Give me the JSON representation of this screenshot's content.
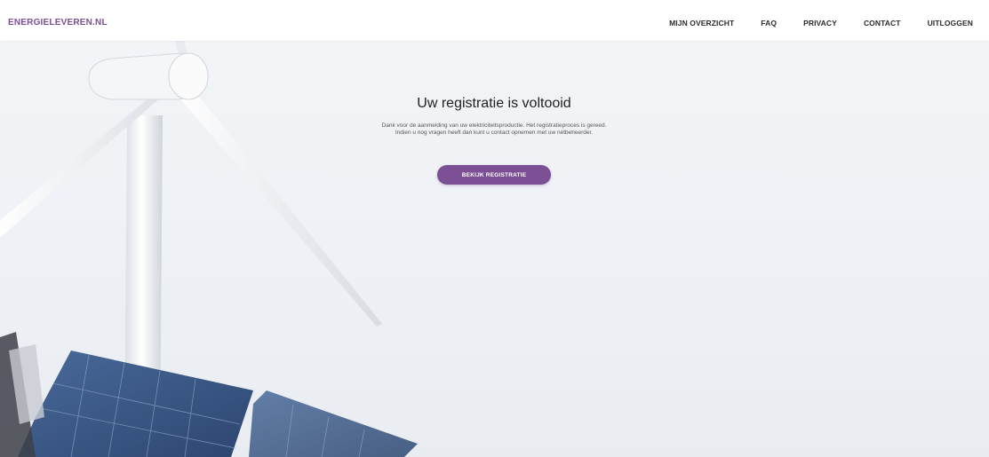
{
  "header": {
    "brand": "ENERGIELEVEREN.NL",
    "nav": [
      {
        "label": "MIJN OVERZICHT"
      },
      {
        "label": "FAQ"
      },
      {
        "label": "PRIVACY"
      },
      {
        "label": "CONTACT"
      },
      {
        "label": "UITLOGGEN"
      }
    ]
  },
  "main": {
    "title": "Uw registratie is voltooid",
    "message_line1": "Dank voor de aanmelding van uw elektriciteitsproductie. Het registratieproces is gereed.",
    "message_line2": "Indien u nog vragen heeft dan kunt u contact opnemen met uw netbeheerder.",
    "button_label": "BEKIJK REGISTRATIE"
  },
  "colors": {
    "accent": "#7a4f93",
    "background": "#f4f6f9",
    "nav_text": "#2b2b2b"
  }
}
